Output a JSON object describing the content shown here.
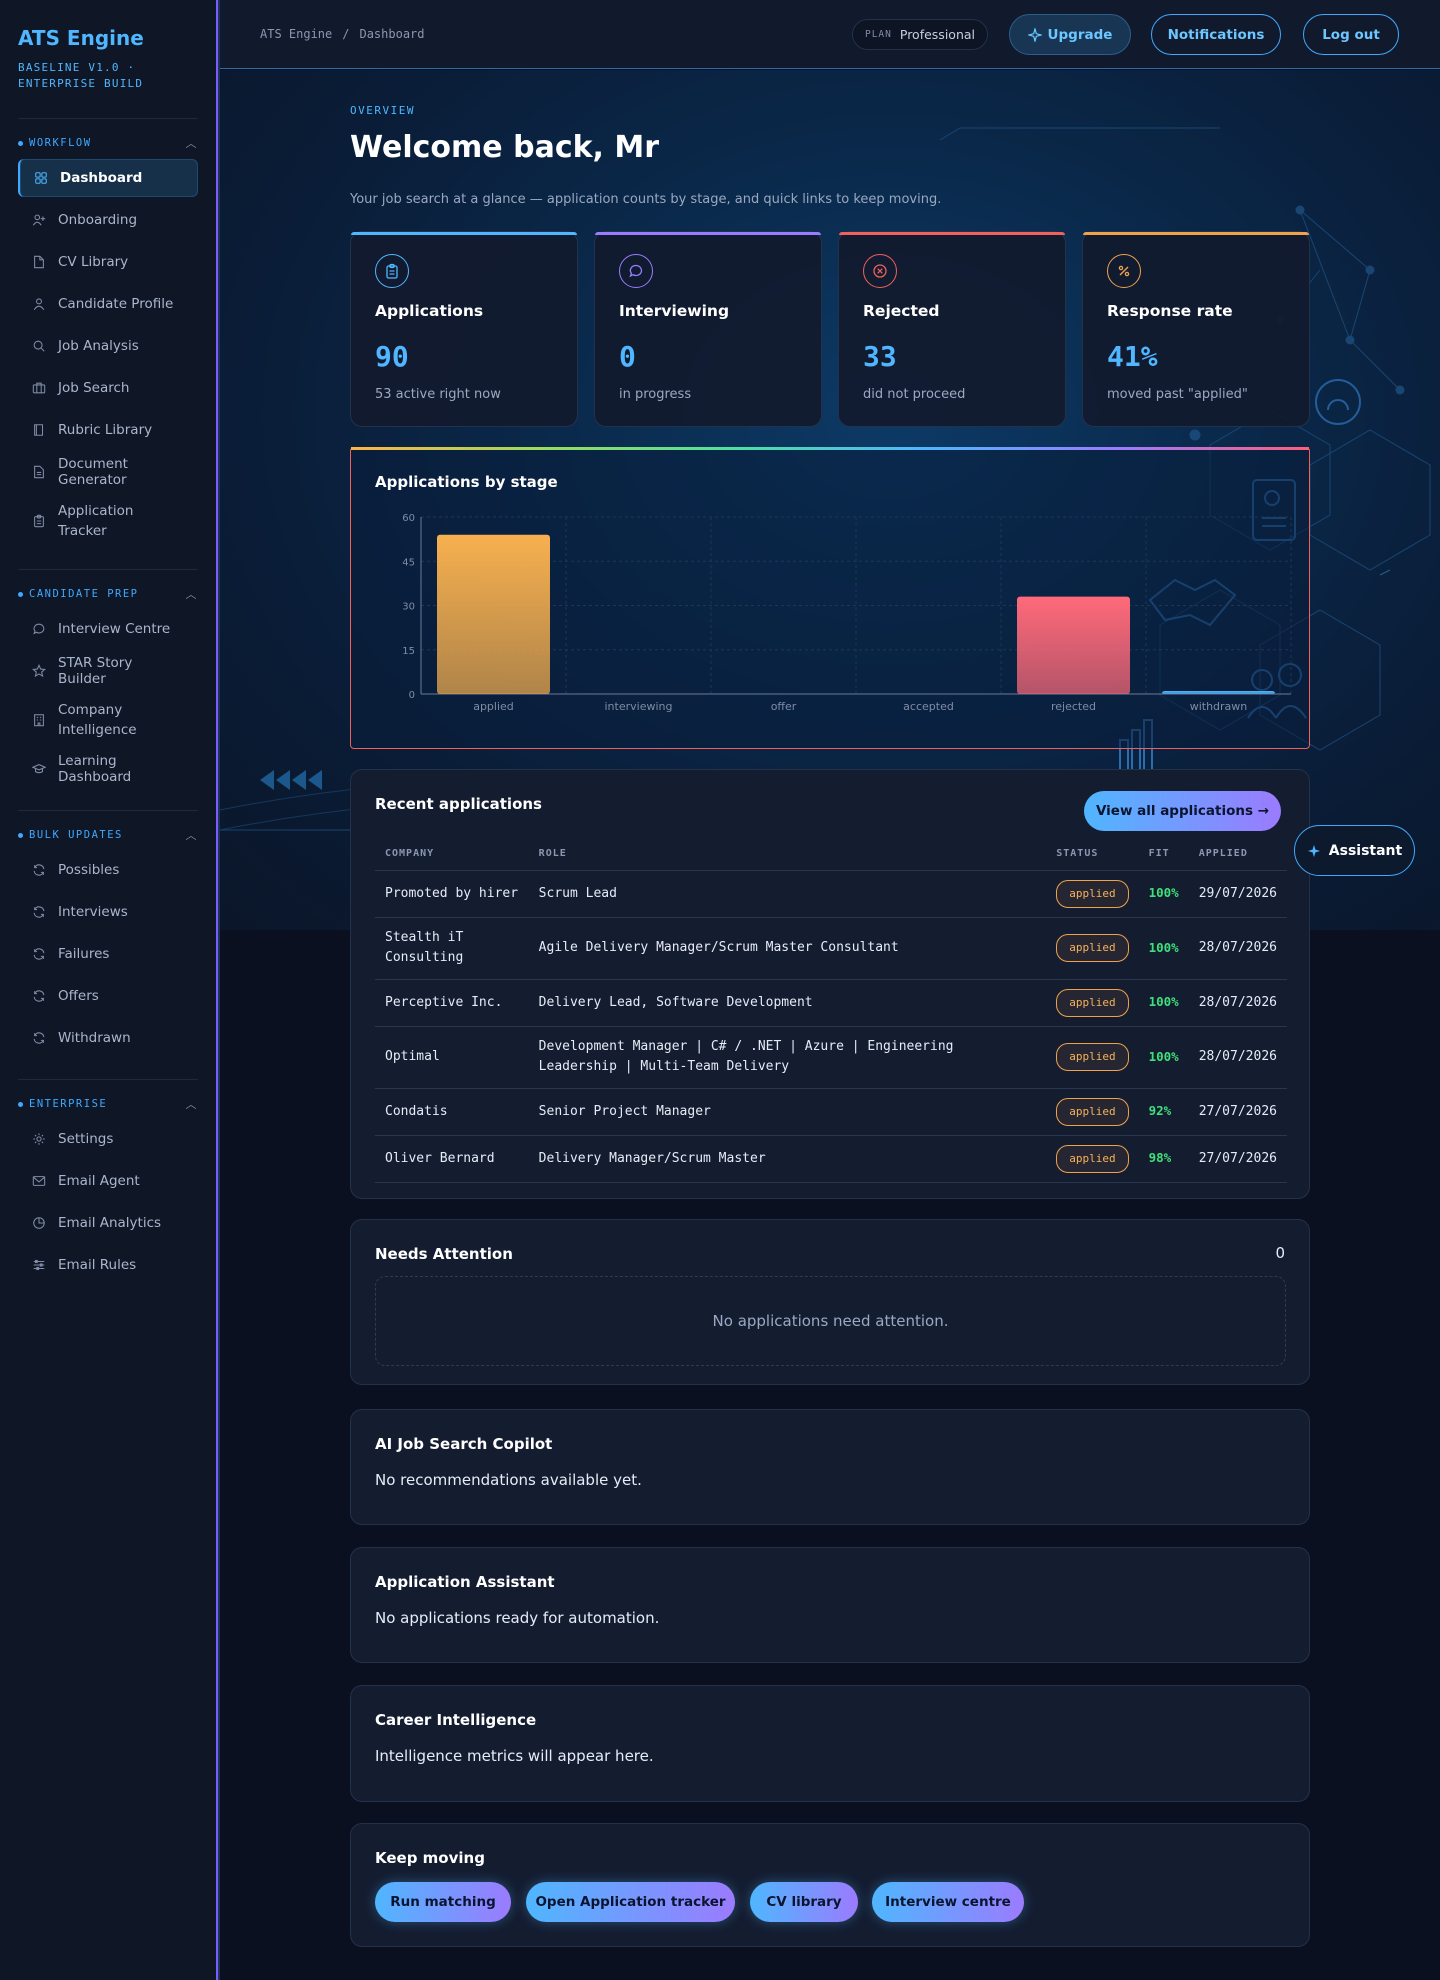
{
  "app": {
    "title": "ATS Engine",
    "subtitle_line1": "BASELINE V1.0 ·",
    "subtitle_line2": "ENTERPRISE BUILD"
  },
  "sidebar": {
    "sections": [
      {
        "title": "WORKFLOW",
        "items": [
          {
            "label": "Dashboard",
            "icon": "grid-icon",
            "active": true
          },
          {
            "label": "Onboarding",
            "icon": "user-plus-icon"
          },
          {
            "label": "CV Library",
            "icon": "file-icon"
          },
          {
            "label": "Candidate Profile",
            "icon": "user-icon"
          },
          {
            "label": "Job Analysis",
            "icon": "search-icon"
          },
          {
            "label": "Job Search",
            "icon": "briefcase-icon"
          },
          {
            "label": "Rubric Library",
            "icon": "book-icon"
          },
          {
            "label": "Document Generator",
            "icon": "document-icon"
          },
          {
            "label": "Application Tracker",
            "icon": "clipboard-icon"
          }
        ]
      },
      {
        "title": "CANDIDATE PREP",
        "items": [
          {
            "label": "Interview Centre",
            "icon": "chat-icon"
          },
          {
            "label": "STAR Story Builder",
            "icon": "star-icon"
          },
          {
            "label": "Company Intelligence",
            "icon": "building-icon"
          },
          {
            "label": "Learning Dashboard",
            "icon": "graduation-cap-icon"
          }
        ]
      },
      {
        "title": "BULK UPDATES",
        "items": [
          {
            "label": "Possibles",
            "icon": "refresh-icon"
          },
          {
            "label": "Interviews",
            "icon": "refresh-icon"
          },
          {
            "label": "Failures",
            "icon": "refresh-icon"
          },
          {
            "label": "Offers",
            "icon": "refresh-icon"
          },
          {
            "label": "Withdrawn",
            "icon": "refresh-icon"
          }
        ]
      },
      {
        "title": "ENTERPRISE",
        "items": [
          {
            "label": "Settings",
            "icon": "gear-icon"
          },
          {
            "label": "Email Agent",
            "icon": "mail-icon"
          },
          {
            "label": "Email Analytics",
            "icon": "pie-chart-icon"
          },
          {
            "label": "Email Rules",
            "icon": "sliders-icon"
          }
        ]
      }
    ]
  },
  "topbar": {
    "breadcrumb": [
      "ATS Engine",
      "Dashboard"
    ],
    "plan_key": "PLAN",
    "plan_value": "Professional",
    "upgrade": "Upgrade",
    "notifications": "Notifications",
    "logout": "Log out"
  },
  "overview": {
    "eyebrow": "OVERVIEW",
    "welcome": "Welcome back, Mr",
    "lead": "Your job search at a glance — application counts by stage, and quick links to keep moving."
  },
  "stats": [
    {
      "label": "Applications",
      "value": "90",
      "note": "53 active right now",
      "accent": "#4fb6ff",
      "icon": "clipboard-icon"
    },
    {
      "label": "Interviewing",
      "value": "0",
      "note": "in progress",
      "accent": "#9b7bff",
      "icon": "chat-icon"
    },
    {
      "label": "Rejected",
      "value": "33",
      "note": "did not proceed",
      "accent": "#f0605c",
      "icon": "x-circle-icon"
    },
    {
      "label": "Response rate",
      "value": "41%",
      "note": "moved past \"applied\"",
      "accent": "#f0a24a",
      "icon": "percent-icon"
    }
  ],
  "chart_data": {
    "type": "bar",
    "title": "Applications by stage",
    "categories": [
      "applied",
      "interviewing",
      "offer",
      "accepted",
      "rejected",
      "withdrawn"
    ],
    "values": [
      54,
      0,
      0,
      0,
      33,
      1
    ],
    "colors": [
      "#f7b04f",
      "#4fb6ff",
      "#4fb6ff",
      "#4fb6ff",
      "#ff6a7a",
      "#4fb6ff"
    ],
    "yticks": [
      0,
      15,
      30,
      45,
      60
    ],
    "ylim": [
      0,
      60
    ],
    "grid": true
  },
  "recent": {
    "title": "Recent applications",
    "view_all": "View all applications →",
    "columns": [
      "COMPANY",
      "ROLE",
      "STATUS",
      "FIT",
      "APPLIED"
    ],
    "rows": [
      {
        "company": "Promoted by hirer",
        "role": "Scrum Lead",
        "status": "applied",
        "fit": "100%",
        "applied": "29/07/2026"
      },
      {
        "company": "Stealth iT Consulting",
        "role": "Agile Delivery Manager/Scrum Master Consultant",
        "status": "applied",
        "fit": "100%",
        "applied": "28/07/2026"
      },
      {
        "company": "Perceptive Inc.",
        "role": "Delivery Lead, Software Development",
        "status": "applied",
        "fit": "100%",
        "applied": "28/07/2026"
      },
      {
        "company": "Optimal",
        "role": "Development Manager | C# / .NET | Azure | Engineering Leadership | Multi-Team Delivery",
        "status": "applied",
        "fit": "100%",
        "applied": "28/07/2026"
      },
      {
        "company": "Condatis",
        "role": "Senior Project Manager",
        "status": "applied",
        "fit": "92%",
        "applied": "27/07/2026"
      },
      {
        "company": "Oliver Bernard",
        "role": "Delivery Manager/Scrum Master",
        "status": "applied",
        "fit": "98%",
        "applied": "27/07/2026"
      }
    ]
  },
  "assistant": {
    "label": "Assistant"
  },
  "attention": {
    "title": "Needs Attention",
    "count": "0",
    "empty": "No applications need attention."
  },
  "copilot": {
    "title": "AI Job Search Copilot",
    "text": "No recommendations available yet."
  },
  "app_assistant": {
    "title": "Application Assistant",
    "text": "No applications ready for automation."
  },
  "career": {
    "title": "Career Intelligence",
    "text": "Intelligence metrics will appear here."
  },
  "keep_moving": {
    "title": "Keep moving",
    "buttons": [
      "Run matching",
      "Open Application tracker",
      "CV library",
      "Interview centre"
    ]
  }
}
